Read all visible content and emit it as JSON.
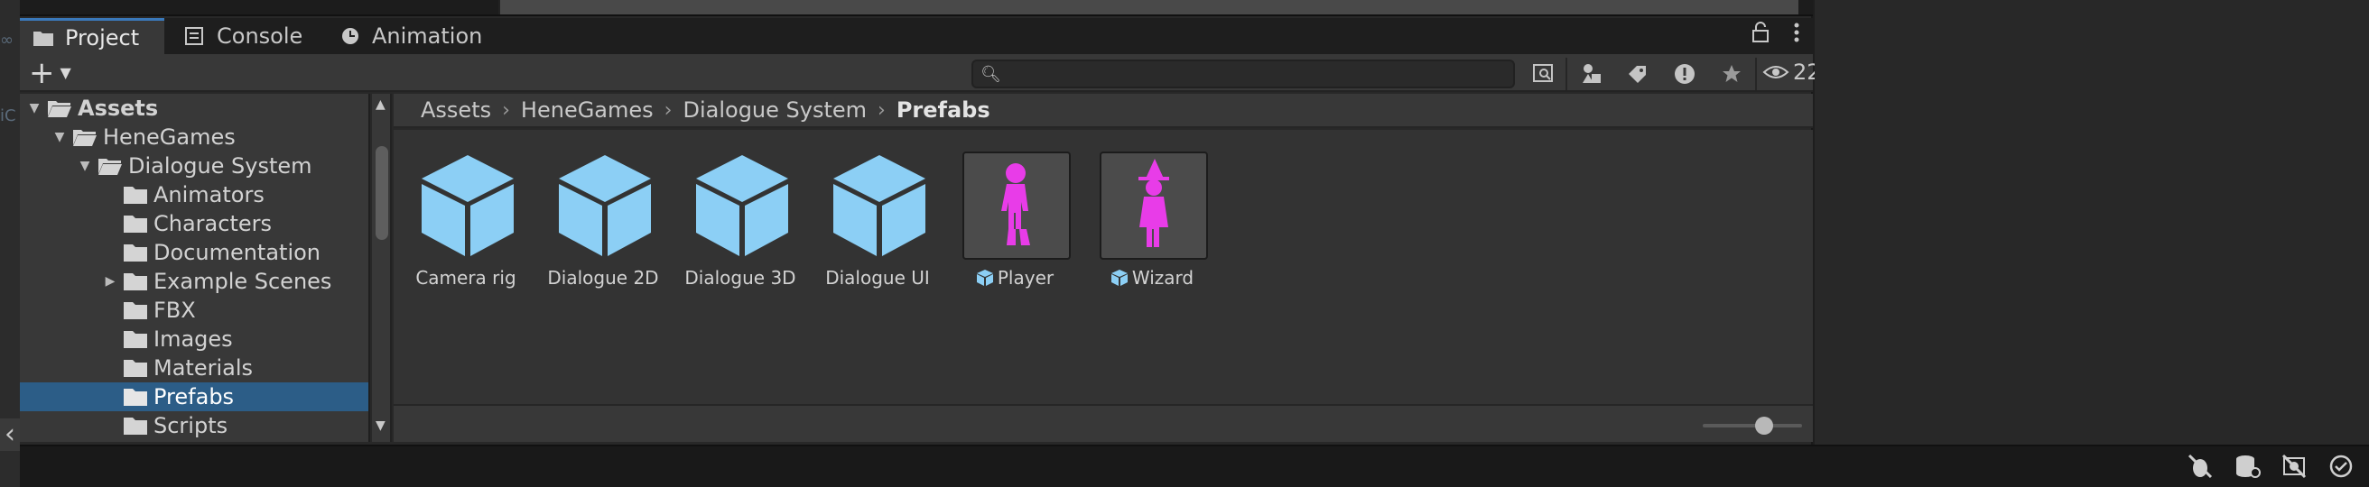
{
  "tabs": [
    {
      "label": "Project",
      "icon": "folder-icon",
      "active": true
    },
    {
      "label": "Console",
      "icon": "console-icon",
      "active": false
    },
    {
      "label": "Animation",
      "icon": "clock-icon",
      "active": false
    }
  ],
  "toolbar": {
    "add_label": "+",
    "search_placeholder": "",
    "visible_count": "22"
  },
  "tree": [
    {
      "label": "Assets",
      "expanded": true,
      "bold": true,
      "has_arrow": true
    },
    {
      "label": "HeneGames",
      "expanded": true,
      "has_arrow": true
    },
    {
      "label": "Dialogue System",
      "expanded": true,
      "has_arrow": true
    },
    {
      "label": "Animators",
      "has_arrow": false
    },
    {
      "label": "Characters",
      "has_arrow": false
    },
    {
      "label": "Documentation",
      "has_arrow": false
    },
    {
      "label": "Example Scenes",
      "has_arrow": true,
      "expanded": false
    },
    {
      "label": "FBX",
      "has_arrow": false
    },
    {
      "label": "Images",
      "has_arrow": false
    },
    {
      "label": "Materials",
      "has_arrow": false
    },
    {
      "label": "Prefabs",
      "has_arrow": false,
      "selected": true
    },
    {
      "label": "Scripts",
      "has_arrow": false
    }
  ],
  "breadcrumb": [
    "Assets",
    "HeneGames",
    "Dialogue System",
    "Prefabs"
  ],
  "assets": [
    {
      "name": "Camera rig",
      "kind": "prefab-cube"
    },
    {
      "name": "Dialogue 2D",
      "kind": "prefab-cube"
    },
    {
      "name": "Dialogue 3D",
      "kind": "prefab-cube"
    },
    {
      "name": "Dialogue UI",
      "kind": "prefab-cube"
    },
    {
      "name": "Player",
      "kind": "character-preview"
    },
    {
      "name": "Wizard",
      "kind": "wizard-preview"
    }
  ],
  "colors": {
    "selection": "#2c5d87",
    "cube": "#8ccff5",
    "character": "#e83ce8",
    "tab_accent": "#3a79bb"
  },
  "thumbnail_size_slider": 0.5
}
